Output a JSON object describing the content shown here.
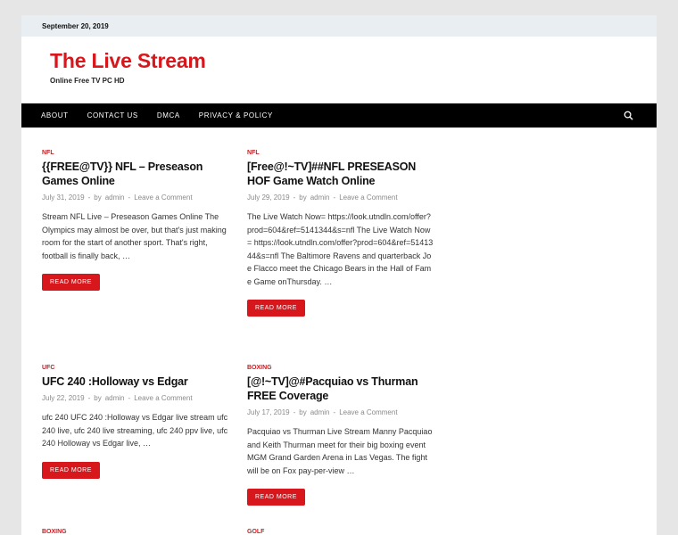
{
  "topbar": {
    "date": "September 20, 2019"
  },
  "site": {
    "title": "The Live Stream",
    "description": "Online Free TV PC HD"
  },
  "nav": {
    "items": [
      "ABOUT",
      "CONTACT US",
      "DMCA",
      "PRIVACY & POLICY"
    ]
  },
  "posts": [
    {
      "category": "NFL",
      "title": "{{FREE@TV}} NFL – Preseason Games Online",
      "date": "July 31, 2019",
      "by": "by",
      "author": "admin",
      "comment": "Leave a Comment",
      "excerpt": "Stream NFL Live – Preseason Games Online The Olympics may almost be over, but that's just making room for the start of another sport. That's right, football is finally back, …",
      "button": "READ MORE"
    },
    {
      "category": "NFL",
      "title": "[Free@!~TV]##NFL PRESEASON HOF Game Watch Online",
      "date": "July 29, 2019",
      "by": "by",
      "author": "admin",
      "comment": "Leave a Comment",
      "excerpt": "The Live Watch Now= https://look.utndln.com/offer?prod=604&ref=5141344&s=nfl The Live Watch Now= https://look.utndln.com/offer?prod=604&ref=5141344&s=nfl      The Baltimore Ravens and quarterback Joe Flacco meet the Chicago Bears in the Hall of Fame Game onThursday. …",
      "button": "READ MORE"
    },
    {
      "category": "UFC",
      "title": "UFC 240 :Holloway vs Edgar",
      "date": "July 22, 2019",
      "by": "by",
      "author": "admin",
      "comment": "Leave a Comment",
      "excerpt": "ufc 240 UFC 240 :Holloway vs Edgar live stream ufc 240 live, ufc 240 live streaming, ufc 240 ppv live, ufc 240 Holloway vs Edgar live, …",
      "button": "READ MORE"
    },
    {
      "category": "BOXING",
      "title": "[@!~TV]@#Pacquiao vs Thurman FREE Coverage",
      "date": "July 17, 2019",
      "by": "by",
      "author": "admin",
      "comment": "Leave a Comment",
      "excerpt": "Pacquiao vs Thurman Live Stream Manny Pacquiao and Keith Thurman meet for their big boxing event MGM Grand Garden Arena in Las Vegas. The fight will be on Fox pay-per-view …",
      "button": "READ MORE"
    }
  ],
  "next_categories": [
    "BOXING",
    "GOLF"
  ],
  "meta_separator": "-",
  "colors": {
    "accent": "#d7171c",
    "nav_bg": "#000000",
    "topbar_bg": "#e9eef2"
  }
}
